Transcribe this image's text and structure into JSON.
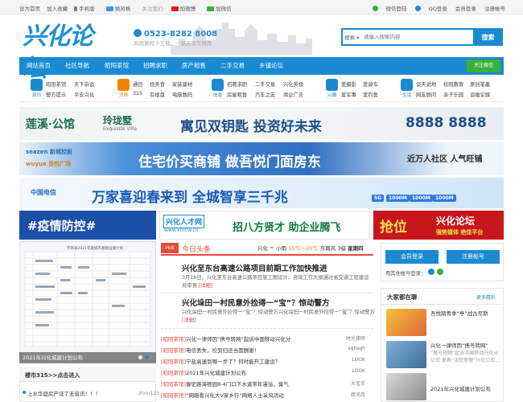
{
  "topbar": {
    "left": [
      "设为首页",
      "加入收藏",
      "手机版",
      "换风格",
      "关注我们:",
      "加微博",
      "加微信"
    ],
    "right": [
      "微信登陆",
      "QQ登录",
      "会员登录",
      "注册帐号"
    ]
  },
  "header": {
    "logo": "兴化论坛",
    "phone": "0523-8282 8008",
    "slogan": "风雨兼程十五载，一路高歌写辉煌",
    "search_select": "搜索",
    "search_placeholder": "请输入搜索内容",
    "search_button": "搜索"
  },
  "nav": {
    "items": [
      "网站首页",
      "社区导航",
      "昭阳茶馆",
      "招聘求职",
      "房产租售",
      "二手交易",
      "乡镇论坛"
    ],
    "wechat": "关注微信"
  },
  "quick": [
    {
      "cap": "资讯",
      "icon": "news-icon",
      "color": "#1a8ad2",
      "links": [
        "昭阳茶馆",
        "天下杂谈",
        "警方提示",
        "平安兴化"
      ]
    },
    {
      "cap": "消费",
      "icon": "consume-icon",
      "color": "#f08300",
      "links": [
        "通信",
        "找美食",
        "家装建材",
        "315",
        "有楼盘",
        "电脑数码"
      ]
    },
    {
      "cap": "信息",
      "icon": "info-icon",
      "color": "#1a8ad2",
      "links": [
        "招聘求职",
        "二手交易",
        "兴化美食",
        "房屋租售",
        "汽车之友",
        "商业广告"
      ]
    },
    {
      "cap": "兴趣",
      "icon": "hobby-icon",
      "color": "#1a8ad2",
      "links": [
        "爱摄影",
        "爱骑车",
        "爱军事",
        "爱钓鱼"
      ]
    },
    {
      "cap": "生活",
      "icon": "life-icon",
      "color": "#1a8ad2",
      "links": [
        "谈天说地",
        "校园教育",
        "原创笔墨",
        "网友顾问",
        "亲子乐园",
        "谈婚论嫁"
      ]
    }
  ],
  "banners": [
    {
      "left": "莲溪·公馆",
      "mid": "玲珑墅",
      "mid_sub": "Exquisite Villa",
      "slogan": "寓见双钥匙 投资好未来",
      "phone": "8888 8888"
    },
    {
      "brand1": "seazen 新城控股",
      "brand2": "wuyue 吾悦广场",
      "slogan": "住宅价买商铺 做吾悦门面房东",
      "right": "近万人社区 人气旺铺"
    },
    {
      "brand": "中国电信",
      "slogan": "万家喜迎春来到  全城智享三千兆",
      "badges": [
        "5G",
        "1000M",
        "1000M",
        "1000M"
      ]
    },
    {
      "left": "#疫情防控#",
      "mid": "兴化人才网",
      "mid_sub": "www.xhrcw.cn",
      "mid_slogan": "招八方贤才 助企业腾飞",
      "right1": "抢位",
      "right2": "兴化论坛",
      "right_sub": "强势媒体 绝佳平台"
    }
  ],
  "slider": {
    "doc_title": "节目表2021年度城市基础设施计划",
    "caption": "2021年兴化城建计划公布"
  },
  "tie": {
    "title": "楼市315>>点击进入",
    "line": "上水华庭房产证了无音讯！！！",
    "user": "zhou123"
  },
  "weather": {
    "city": "兴化",
    "cond": "小雨",
    "temp": "15℃～20℃",
    "wind": "东南风 3级",
    "day": "星期四"
  },
  "hot": {
    "tab": "Hot",
    "title": "今日头条",
    "headlines": [
      {
        "title": "兴化至东台高速公路项目前期工作加快推进",
        "summary": "3月16日，兴化至东台高速公路项目施工图设计、咨询工作大纲通过省交通工程建设",
        "summary2": "局审查",
        "detail": "[详细]"
      },
      {
        "title": "兴化垛田一村民意外捡得一“宝”？惊动警方",
        "summary": "兴化垛田一村民意外捡得一“宝”？惊动警方兴化垛田一村民意外捡得一“宝”？惊动警方",
        "detail": "[详细]"
      }
    ],
    "items": [
      {
        "tag": "[昭阳茶馆]",
        "text": "兴化一律师因“携号转网”起诉中国移动兴化分",
        "user": "时光律师"
      },
      {
        "tag": "[昭阳茶馆]",
        "text": "电信丢失，捡到归还当面酬谢！",
        "user": "sqhsqh"
      },
      {
        "tag": "[昭阳茶馆]",
        "text": "宁盐高速到哪一步了？何时能开工建设？",
        "user": "LOOK"
      },
      {
        "tag": "[昭阳茶馆]",
        "text": "2021年兴化城建计划公布",
        "user": "LOOK"
      },
      {
        "tag": "[昭阳茶馆]",
        "text": "御史路海德园8-4门口下水道常年漫溢，臭气",
        "user": "大宝贝"
      },
      {
        "tag": "[昭阳茶馆]",
        "text": "“网眼看兴化大V家乡行”网络人士采风活动",
        "user": "胖河月"
      }
    ]
  },
  "login": {
    "member": "会员登录",
    "register": "注册帐号",
    "quick": "用其他帐号登录："
  },
  "talk": {
    "title": "大家都在聊",
    "more": "更多精彩",
    "items": [
      {
        "text": "吾悦踏青季“亭”战古尼斯",
        "sub": ""
      },
      {
        "text": "兴化一律师因“携号转网”",
        "sub": "“携号转网”起诉中国移动兴化分公司 发表“法院审理”兴化公司…"
      },
      {
        "text": "2021年兴化城建计划公布",
        "sub": ""
      }
    ]
  }
}
